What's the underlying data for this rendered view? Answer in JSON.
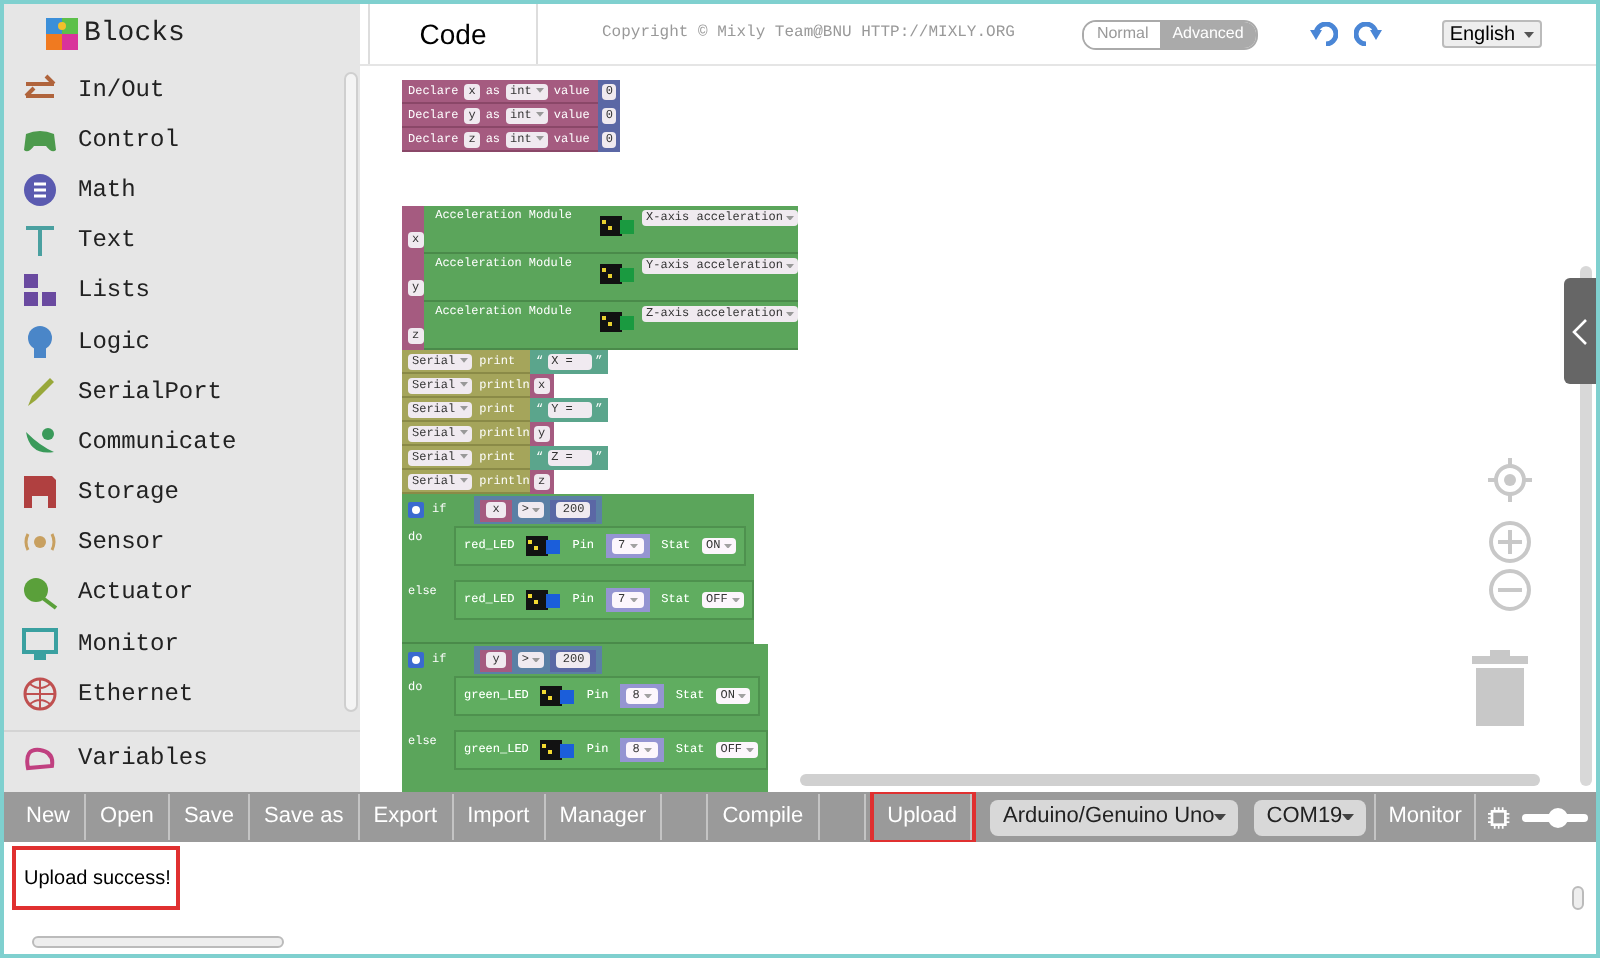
{
  "sidebar": {
    "title": "Blocks",
    "items": [
      {
        "label": "In/Out"
      },
      {
        "label": "Control"
      },
      {
        "label": "Math"
      },
      {
        "label": "Text"
      },
      {
        "label": "Lists"
      },
      {
        "label": "Logic"
      },
      {
        "label": "SerialPort"
      },
      {
        "label": "Communicate"
      },
      {
        "label": "Storage"
      },
      {
        "label": "Sensor"
      },
      {
        "label": "Actuator"
      },
      {
        "label": "Monitor"
      },
      {
        "label": "Ethernet"
      },
      {
        "label": "Variables"
      }
    ]
  },
  "tabs": [
    {
      "label": "Code",
      "selected": true
    }
  ],
  "copyright": "Copyright © Mixly Team@BNU HTTP://MIXLY.ORG",
  "mode_toggle": [
    {
      "label": "Normal",
      "selected": false
    },
    {
      "label": "Advanced",
      "selected": true
    }
  ],
  "language": "English",
  "workspace": {
    "declarations": [
      {
        "keyword": "Declare",
        "var": "x",
        "as": "as",
        "type": "int",
        "value_label": "value",
        "value": "0"
      },
      {
        "keyword": "Declare",
        "var": "y",
        "as": "as",
        "type": "int",
        "value_label": "value",
        "value": "0"
      },
      {
        "keyword": "Declare",
        "var": "z",
        "as": "as",
        "type": "int",
        "value_label": "value",
        "value": "0"
      }
    ],
    "sensor_reads": [
      {
        "var": "x",
        "module": "Acceleration Module",
        "option": "X-axis acceleration"
      },
      {
        "var": "y",
        "module": "Acceleration Module",
        "option": "Y-axis acceleration"
      },
      {
        "var": "z",
        "module": "Acceleration Module",
        "option": "Z-axis acceleration"
      }
    ],
    "serial_calls": [
      {
        "port": "Serial",
        "method": "print",
        "kind": "text",
        "arg": "X =",
        "quote_open": "“",
        "quote_close": "”"
      },
      {
        "port": "Serial",
        "method": "println",
        "kind": "variable",
        "arg": "x"
      },
      {
        "port": "Serial",
        "method": "print",
        "kind": "text",
        "arg": "Y =",
        "quote_open": "“",
        "quote_close": "”"
      },
      {
        "port": "Serial",
        "method": "println",
        "kind": "variable",
        "arg": "y"
      },
      {
        "port": "Serial",
        "method": "print",
        "kind": "text",
        "arg": "Z =",
        "quote_open": "“",
        "quote_close": "”"
      },
      {
        "port": "Serial",
        "method": "println",
        "kind": "variable",
        "arg": "z"
      }
    ],
    "conditionals": [
      {
        "keyword": "if",
        "var": "x",
        "op": ">",
        "value": "200",
        "branches": [
          {
            "label": "do",
            "device": "red_LED",
            "pin_label": "Pin",
            "pin": "7",
            "stat_label": "Stat",
            "stat": "ON"
          },
          {
            "label": "else",
            "device": "red_LED",
            "pin_label": "Pin",
            "pin": "7",
            "stat_label": "Stat",
            "stat": "OFF"
          }
        ]
      },
      {
        "keyword": "if",
        "var": "y",
        "op": ">",
        "value": "200",
        "branches": [
          {
            "label": "do",
            "device": "green_LED",
            "pin_label": "Pin",
            "pin": "8",
            "stat_label": "Stat",
            "stat": "ON"
          },
          {
            "label": "else",
            "device": "green_LED",
            "pin_label": "Pin",
            "pin": "8",
            "stat_label": "Stat",
            "stat": "OFF"
          }
        ]
      }
    ]
  },
  "toolbar": {
    "items": [
      {
        "kind": "button",
        "label": "New",
        "highlighted": false
      },
      {
        "kind": "button",
        "label": "Open",
        "highlighted": false
      },
      {
        "kind": "button",
        "label": "Save",
        "highlighted": false
      },
      {
        "kind": "button",
        "label": "Save as",
        "highlighted": false
      },
      {
        "kind": "button",
        "label": "Export",
        "highlighted": false
      },
      {
        "kind": "button",
        "label": "Import",
        "highlighted": false
      },
      {
        "kind": "button",
        "label": "Manager",
        "highlighted": false
      },
      {
        "kind": "spacer"
      },
      {
        "kind": "button",
        "label": "Compile",
        "highlighted": false
      },
      {
        "kind": "spacer"
      },
      {
        "kind": "button",
        "label": "Upload",
        "highlighted": true
      }
    ],
    "board": "Arduino/Genuino Uno",
    "port": "COM19",
    "monitor": "Monitor",
    "zoom": {
      "level": 0.55
    }
  },
  "output": {
    "message": "Upload success!",
    "highlighted": true
  }
}
